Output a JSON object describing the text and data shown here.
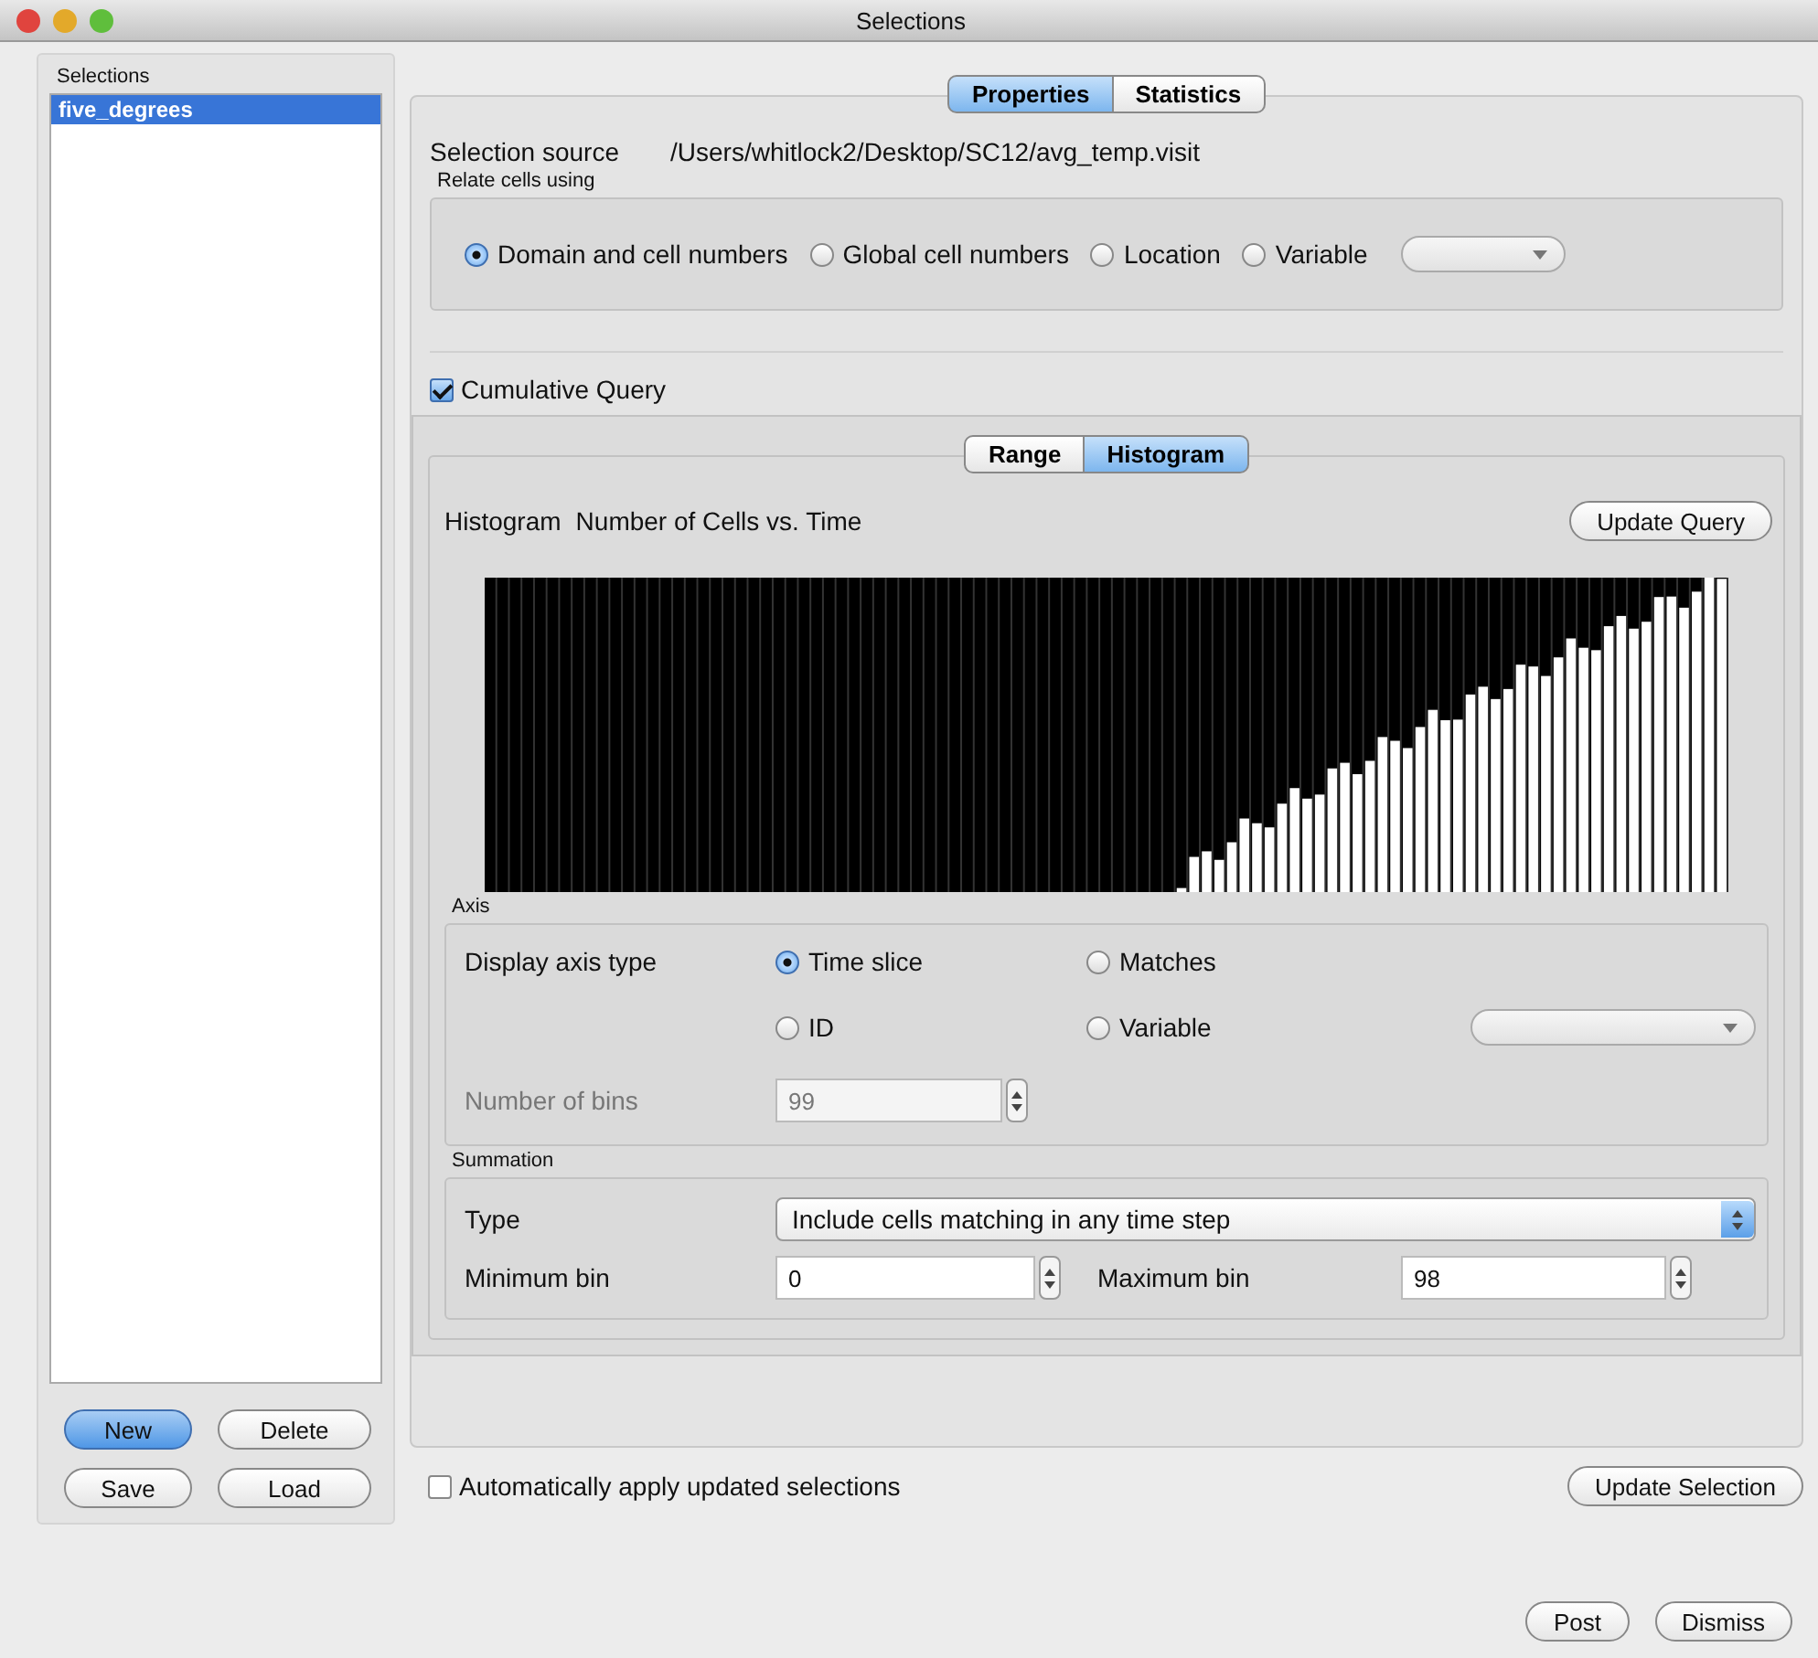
{
  "window": {
    "title": "Selections"
  },
  "selections": {
    "label": "Selections",
    "items": [
      {
        "name": "five_degrees",
        "selected": true
      }
    ],
    "buttons": [
      {
        "label": "New",
        "default": true
      },
      {
        "label": "Delete",
        "default": false
      },
      {
        "label": "Save",
        "default": false
      },
      {
        "label": "Load",
        "default": false
      }
    ]
  },
  "tabs": [
    {
      "label": "Properties",
      "selected": true
    },
    {
      "label": "Statistics",
      "selected": false
    }
  ],
  "source": {
    "label": "Selection source",
    "value": "/Users/whitlock2/Desktop/SC12/avg_temp.visit"
  },
  "relate": {
    "label": "Relate cells using",
    "options": [
      {
        "label": "Domain and cell numbers",
        "selected": true
      },
      {
        "label": "Global cell numbers",
        "selected": false
      },
      {
        "label": "Location",
        "selected": false
      },
      {
        "label": "Variable",
        "selected": false
      }
    ]
  },
  "cumulative": {
    "label": "Cumulative Query",
    "checked": true
  },
  "query_tabs": [
    {
      "label": "Range",
      "selected": false
    },
    {
      "label": "Histogram",
      "selected": true
    }
  ],
  "histogram": {
    "label": "Histogram",
    "title": "Number of Cells vs. Time",
    "button": "Update Query"
  },
  "axis": {
    "label": "Axis",
    "type_label": "Display axis type",
    "options": [
      {
        "label": "Time slice",
        "selected": true
      },
      {
        "label": "Matches",
        "selected": false
      },
      {
        "label": "ID",
        "selected": false
      },
      {
        "label": "Variable",
        "selected": false
      }
    ],
    "bins_label": "Number of bins",
    "bins": "99",
    "bins_disabled": true
  },
  "summation": {
    "label": "Summation",
    "type_label": "Type",
    "type": "Include cells matching in any time step",
    "min_label": "Minimum bin",
    "min": "0",
    "max_label": "Maximum bin",
    "max": "98"
  },
  "auto_apply": {
    "label": "Automatically apply updated selections",
    "checked": false
  },
  "update_button": "Update Selection",
  "footer_buttons": [
    "Post",
    "Dismiss"
  ]
}
